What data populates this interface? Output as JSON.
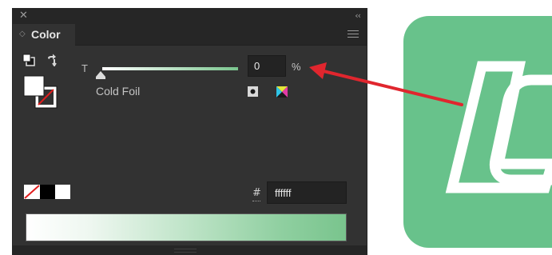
{
  "window": {
    "close_icon": "close-icon",
    "collapse_glyph": "‹‹"
  },
  "panel": {
    "tab_label": "Color",
    "tab_arrows": "◇",
    "menu_icon": "hamburger-menu-icon"
  },
  "tint": {
    "label": "T",
    "value": "0",
    "unit": "%",
    "spot_name": "Cold Foil",
    "level_fraction": 0.0
  },
  "hex": {
    "hash": "#",
    "value": "ffffff"
  },
  "swatches": {
    "fill": "#ffffff",
    "ramp_start": "#ffffff",
    "ramp_end": "#79c48d"
  },
  "artwork": {
    "background_color": "#68c28b",
    "letter_text": "L",
    "arrow_color": "#e0262e"
  }
}
